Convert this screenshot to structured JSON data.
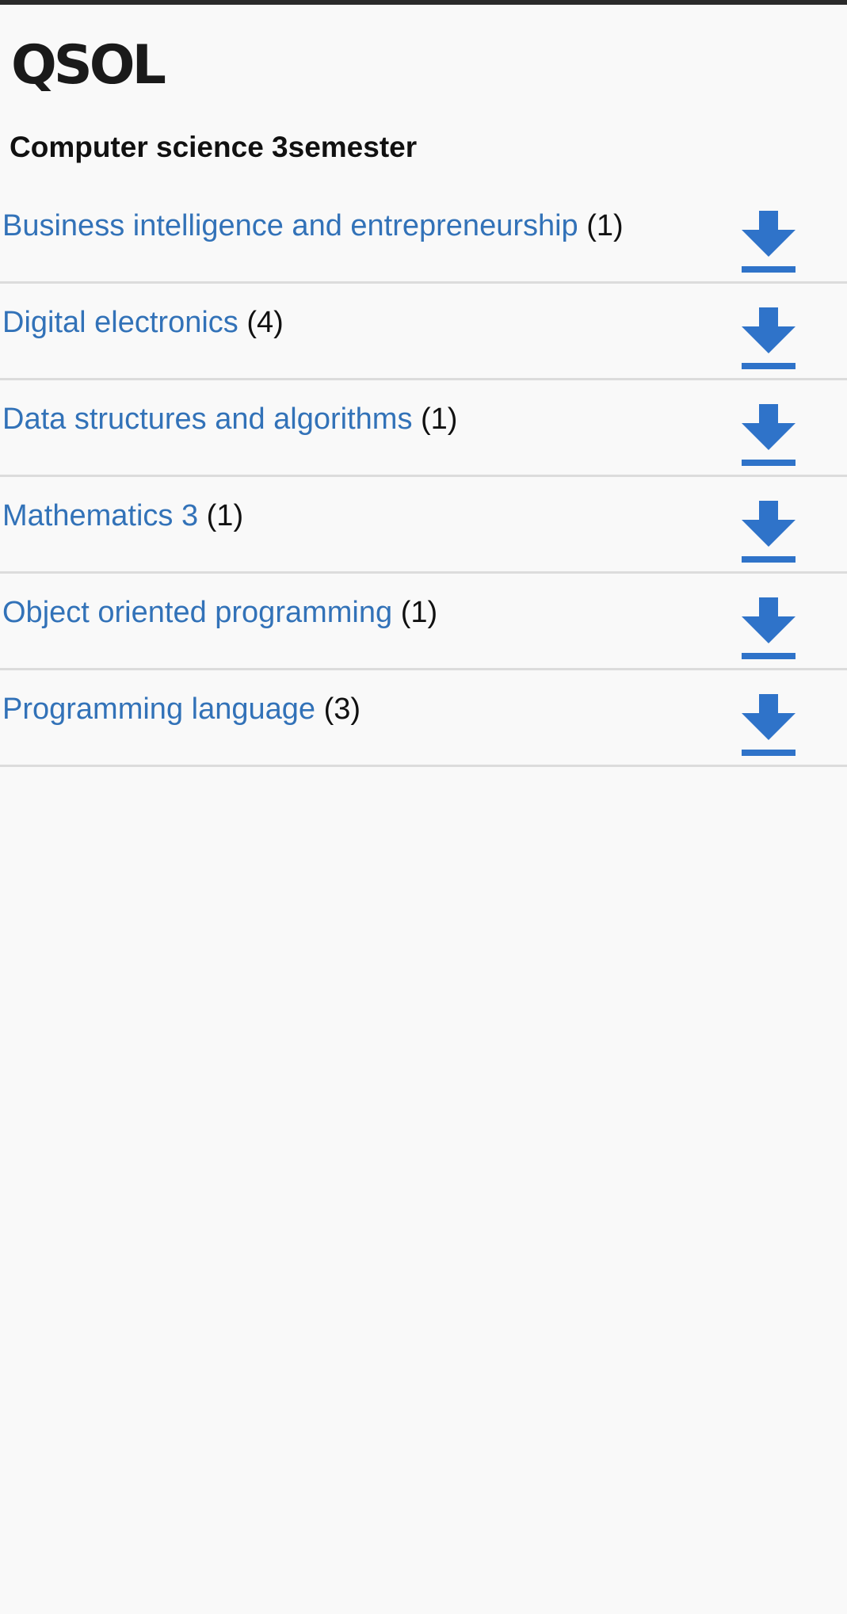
{
  "brand": {
    "logo_text": "QSOL"
  },
  "page": {
    "title": "Computer science 3semester"
  },
  "subjects": [
    {
      "name": "Business intelligence and entrepreneurship",
      "count": "(1)"
    },
    {
      "name": "Digital electronics",
      "count": "(4)"
    },
    {
      "name": "Data structures and algorithms",
      "count": "(1)"
    },
    {
      "name": "Mathematics 3",
      "count": "(1)"
    },
    {
      "name": "Object oriented programming",
      "count": "(1)"
    },
    {
      "name": "Programming language",
      "count": "(3)"
    }
  ],
  "icons": {
    "download": "download-icon"
  },
  "colors": {
    "link": "#3272b8",
    "icon": "#2f73c9",
    "divider": "#dcdcdc",
    "background": "#f9f9f9",
    "top_bar": "#2b2b2b"
  }
}
